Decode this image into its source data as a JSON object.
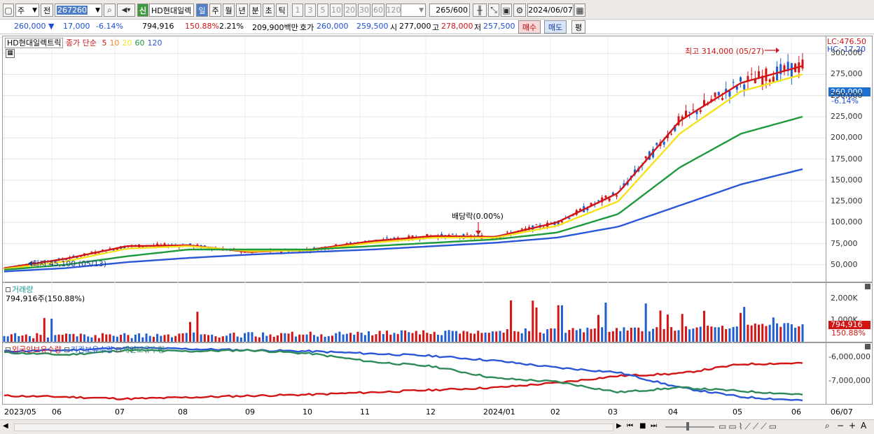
{
  "toolbar": {
    "market_label": "주",
    "prev_label": "전",
    "code": "267260",
    "new_badge": "신",
    "stock_name": "HD현대일렉",
    "periods": [
      "일",
      "주",
      "월",
      "년",
      "분",
      "초",
      "틱"
    ],
    "active_period": "일",
    "intervals": [
      "1",
      "3",
      "5",
      "10",
      "20",
      "30",
      "60",
      "120"
    ],
    "count": "265",
    "count_total": "/600",
    "date": "2024/06/07"
  },
  "price_info": {
    "price": "260,000",
    "change_arrow": "▼",
    "change": "17,000",
    "change_pct": "-6.14%",
    "volume": "794,916",
    "volume_ratio": "150.88%",
    "turnover": "2.21%",
    "amount": "209,900백만",
    "quote_label": "호가",
    "bid": "260,000",
    "ask": "259,500",
    "open_label": "시",
    "open": "277,000",
    "high_label": "고",
    "high": "278,000",
    "low_label": "저",
    "low": "257,500",
    "buy_button": "매수",
    "sell_button": "매도",
    "eval_button": "평"
  },
  "price_pane": {
    "legend_name": "HD현대일렉트릭",
    "legend_ma_label": "종가 단순",
    "ma_periods": [
      "5",
      "10",
      "20",
      "60",
      "120"
    ],
    "ma_colors": [
      "#d21414",
      "#f08a1c",
      "#f5e21a",
      "#1e9a3c",
      "#2a56d8"
    ],
    "lc_label": "LC:476.50",
    "hc_label": "HC:-17.20",
    "high_annotation": "최고 314,000 (05/27)",
    "low_annotation": "최저 45,100 (05/13)",
    "dividend_annotation": "배당락(0.00%)",
    "current_price_tag": "260,000",
    "current_pct_tag": "-6.14%",
    "yticks": [
      "300,000",
      "275,000",
      "250,000",
      "225,000",
      "200,000",
      "175,000",
      "150,000",
      "125,000",
      "100,000",
      "75,000",
      "50,000"
    ]
  },
  "volume_pane": {
    "title": "거래량",
    "value_text": "794,916주(150.88%)",
    "yticks": [
      "2,000K",
      "1,000K"
    ],
    "current_tag": "794,916",
    "current_pct_tag": "150.88%"
  },
  "holdings_pane": {
    "series": [
      {
        "name": "외국인보유수량",
        "color": "#d21414"
      },
      {
        "name": "기관보유수량",
        "color": "#2a56d8"
      },
      {
        "name": "개인보유수량",
        "color": "#2e8b57"
      }
    ],
    "yticks": [
      "-6,000,000",
      "-7,000,000"
    ]
  },
  "x_axis": {
    "labels": [
      "2023/05",
      "06",
      "07",
      "08",
      "09",
      "10",
      "11",
      "12",
      "2024/01",
      "02",
      "03",
      "04",
      "05",
      "06",
      "06/07"
    ]
  },
  "chart_data": {
    "type": "line",
    "title": "HD현대일렉트릭",
    "x": [
      "2023/05",
      "06",
      "07",
      "08",
      "09",
      "10",
      "11",
      "12",
      "2024/01",
      "02",
      "03",
      "04",
      "05",
      "06"
    ],
    "series": [
      {
        "name": "5",
        "values": [
          46000,
          57000,
          72000,
          73000,
          65000,
          68000,
          78000,
          84000,
          83000,
          100000,
          135000,
          220000,
          265000,
          285000
        ]
      },
      {
        "name": "20",
        "values": [
          45000,
          54000,
          69000,
          72000,
          66000,
          67000,
          76000,
          82000,
          82000,
          96000,
          125000,
          205000,
          255000,
          275000
        ]
      },
      {
        "name": "60",
        "values": [
          44000,
          50000,
          60000,
          68000,
          68000,
          68000,
          72000,
          76000,
          80000,
          88000,
          110000,
          165000,
          205000,
          225000
        ]
      },
      {
        "name": "120",
        "values": [
          42000,
          46000,
          53000,
          58000,
          62000,
          65000,
          68000,
          72000,
          76000,
          82000,
          95000,
          120000,
          145000,
          163000
        ]
      }
    ],
    "ylim": [
      30000,
      320000
    ],
    "annotations": [
      "최고 314,000 (05/27)",
      "최저 45,100 (05/13)",
      "배당락(0.00%)"
    ]
  }
}
